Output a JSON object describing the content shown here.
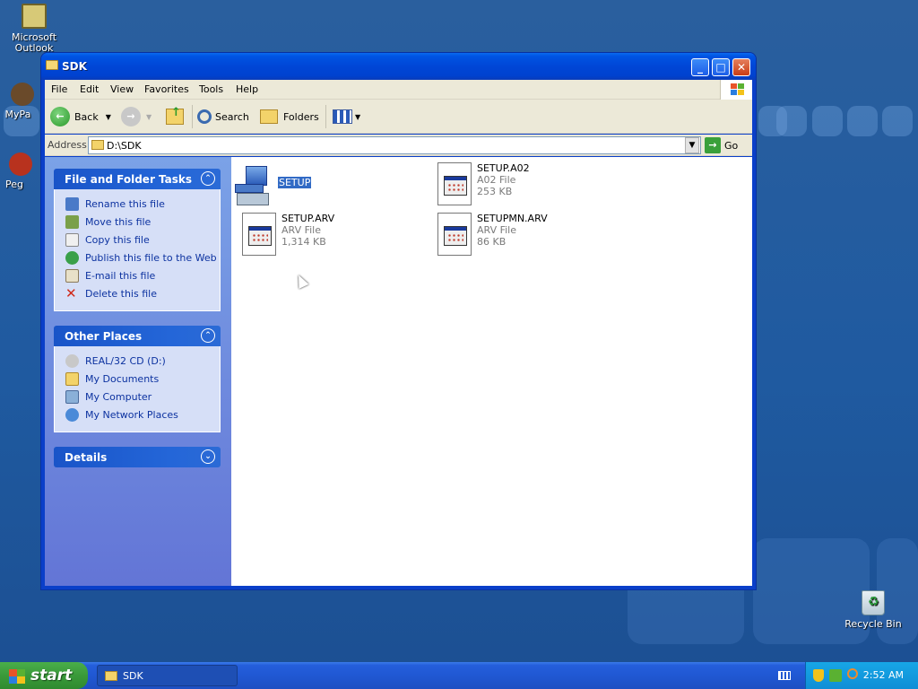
{
  "desktop": {
    "icons": [
      {
        "label": "Microsoft Outlook",
        "icon": "outlook-icon"
      },
      {
        "label": "MyPa",
        "icon": "shortcut-icon"
      },
      {
        "label": "Peg",
        "icon": "shortcut-icon"
      },
      {
        "label": "Recycle Bin",
        "icon": "recycle-bin-icon"
      }
    ]
  },
  "window": {
    "title": "SDK",
    "controls": {
      "minimize": "_",
      "maximize": "□",
      "close": "✕"
    }
  },
  "menubar": [
    "File",
    "Edit",
    "View",
    "Favorites",
    "Tools",
    "Help"
  ],
  "toolbar": {
    "back": "Back",
    "search": "Search",
    "folders": "Folders"
  },
  "address": {
    "label": "Address",
    "value": "D:\\SDK",
    "go": "Go"
  },
  "left_pane": {
    "file_tasks": {
      "title": "File and Folder Tasks",
      "items": [
        "Rename this file",
        "Move this file",
        "Copy this file",
        "Publish this file to the Web",
        "E-mail this file",
        "Delete this file"
      ]
    },
    "other_places": {
      "title": "Other Places",
      "items": [
        "REAL/32 CD (D:)",
        "My Documents",
        "My Computer",
        "My Network Places"
      ]
    },
    "details": {
      "title": "Details"
    }
  },
  "files": [
    {
      "name": "SETUP",
      "type": "",
      "size": "",
      "selected": true,
      "icon": "setup-computer-icon"
    },
    {
      "name": "SETUP.A02",
      "type": "A02 File",
      "size": "253 KB",
      "icon": "generic-file-icon"
    },
    {
      "name": "SETUP.ARV",
      "type": "ARV File",
      "size": "1,314 KB",
      "icon": "generic-file-icon"
    },
    {
      "name": "SETUPMN.ARV",
      "type": "ARV File",
      "size": "86 KB",
      "icon": "generic-file-icon"
    }
  ],
  "taskbar": {
    "start": "start",
    "task": "SDK",
    "clock": "2:52 AM"
  },
  "colors": {
    "titlebar": "#0054e3",
    "selection": "#316ac5",
    "link": "#0c32a0",
    "start_green": "#3a9a3a"
  }
}
